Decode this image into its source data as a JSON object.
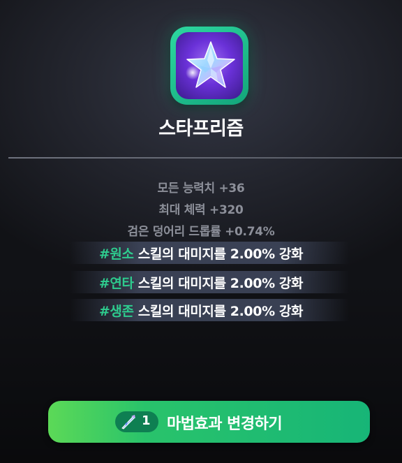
{
  "item": {
    "name": "스타프리즘",
    "icon": "star-prism-icon"
  },
  "stats": [
    "모든 능력치 +36",
    "최대 체력 +320",
    "검은 덩어리 드롭률 +0.74%"
  ],
  "skills": [
    {
      "tag": "#원소",
      "text": " 스킬의 대미지를 2.00% 강화"
    },
    {
      "tag": "#연타",
      "text": " 스킬의 대미지를 2.00% 강화"
    },
    {
      "tag": "#생존",
      "text": " 스킬의 대미지를 2.00% 강화"
    }
  ],
  "action": {
    "cost_icon": "quill-icon",
    "cost_count": "1",
    "label": "마법효과 변경하기"
  },
  "colors": {
    "accent_green": "#2ecb8e",
    "button_green": "#29c36b",
    "icon_frame": "#1fb88a",
    "icon_bg": "#6a31d8"
  }
}
